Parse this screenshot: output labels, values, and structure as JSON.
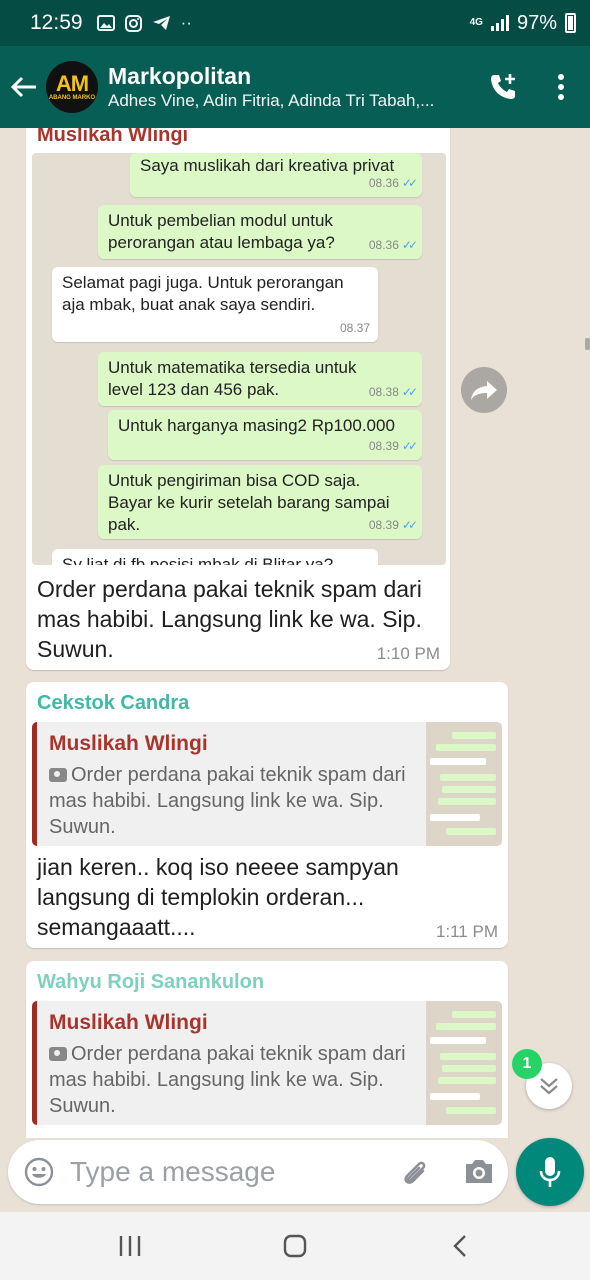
{
  "status_bar": {
    "time": "12:59",
    "network": "4G",
    "battery": "97%",
    "dots": "··"
  },
  "header": {
    "group_name": "Markopolitan",
    "members": "Adhes Vine, Adin Fitria, Adinda Tri Tabah,...",
    "avatar_text": "AM",
    "avatar_subtext": "ABANG MARKO"
  },
  "messages": [
    {
      "sender": "Muslikah Wlingi",
      "sender_color": "#a8352c",
      "image": {
        "bubbles": [
          {
            "dir": "out",
            "text": "Saya muslikah dari kreativa privat",
            "time": "08.36",
            "ticks": "✓✓"
          },
          {
            "dir": "out",
            "text": "Untuk pembelian modul untuk perorangan atau lembaga ya?",
            "time": "08.36",
            "ticks": "✓✓"
          },
          {
            "dir": "in",
            "text": "Selamat pagi juga. Untuk perorangan aja mbak, buat anak saya sendiri.",
            "time": "08.37"
          },
          {
            "dir": "out",
            "text": "Untuk matematika tersedia untuk level 123 dan 456 pak.",
            "time": "08.38",
            "ticks": "✓✓"
          },
          {
            "dir": "out",
            "text": "Untuk harganya masing2 Rp100.000",
            "time": "08.39",
            "ticks": "✓✓"
          },
          {
            "dir": "out",
            "text": "Untuk pengiriman bisa COD saja. Bayar ke kurir setelah barang sampai pak.",
            "time": "08.39",
            "ticks": "✓✓"
          },
          {
            "dir": "in",
            "text": "Sy liat di fb posisi mbak di Blitar ya?",
            "time": ""
          }
        ]
      },
      "text": "Order perdana pakai teknik spam dari mas habibi. Langsung link ke wa. Sip. Suwun.",
      "time": "1:10 PM"
    },
    {
      "sender": "Cekstok Candra",
      "sender_color": "#3fb9a8",
      "quote": {
        "name": "Muslikah Wlingi",
        "text": "Order perdana pakai teknik spam dari mas habibi. Langsung link ke wa. Sip. Suwun."
      },
      "text": "jian keren.. koq iso neeee sampyan langsung di templokin orderan... semangaaatt....",
      "time": "1:11 PM"
    },
    {
      "sender": "Wahyu Roji Sanankulon",
      "sender_color": "#7ed0c0",
      "quote": {
        "name": "Muslikah Wlingi",
        "text": "Order perdana pakai teknik spam dari mas habibi. Langsung link ke wa. Sip. Suwun."
      }
    }
  ],
  "unread_count": "1",
  "compose": {
    "placeholder": "Type a message"
  },
  "colors": {
    "header": "#075e54",
    "status_bar": "#054d44",
    "mic": "#00897b",
    "badge": "#25d366",
    "out_bubble": "#dcf8c6"
  }
}
